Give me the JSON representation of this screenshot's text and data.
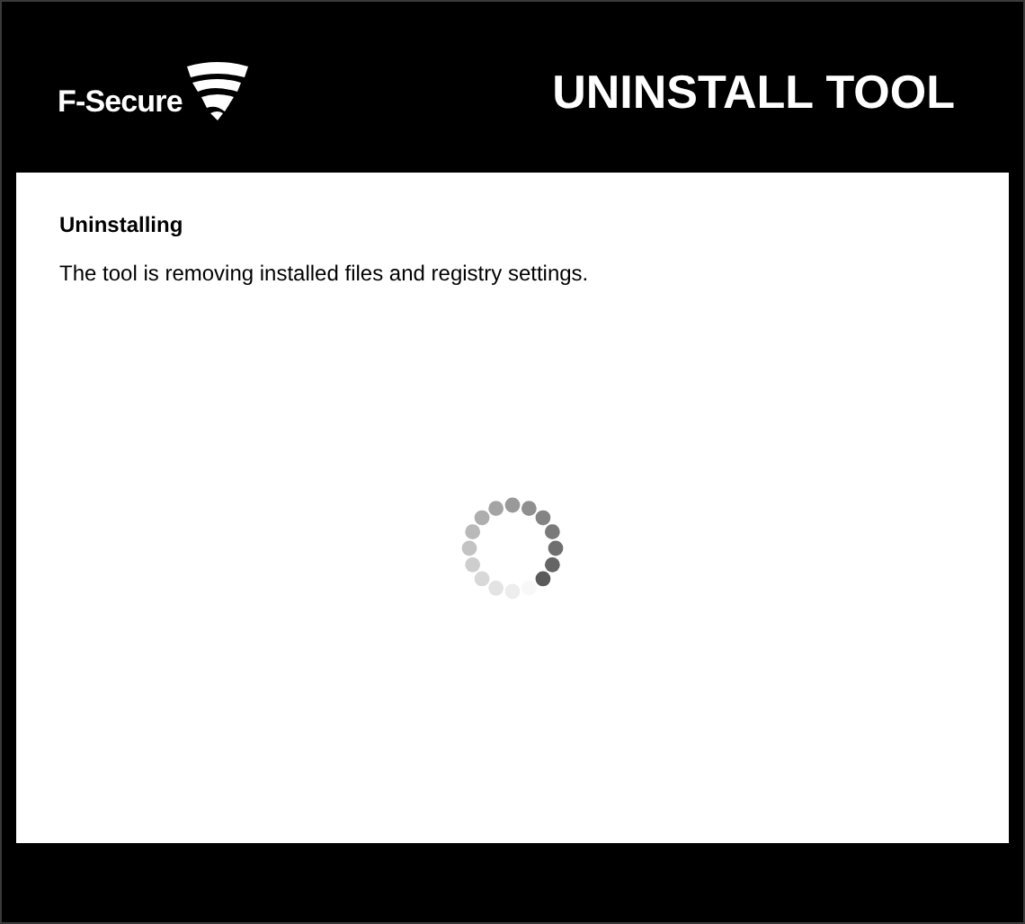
{
  "header": {
    "brand": "F-Secure",
    "title": "UNINSTALL TOOL"
  },
  "panel": {
    "heading": "Uninstalling",
    "message": "The tool is removing installed files and registry settings."
  }
}
